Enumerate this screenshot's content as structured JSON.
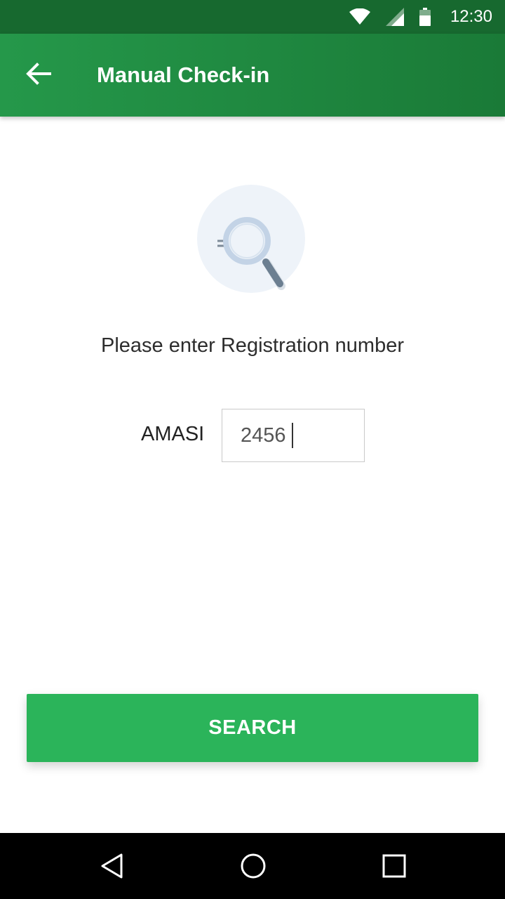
{
  "status_bar": {
    "time": "12:30",
    "icons": [
      "wifi-icon",
      "signal-icon",
      "battery-icon"
    ]
  },
  "app_bar": {
    "title": "Manual Check-in",
    "back_icon": "arrow-left-icon"
  },
  "main": {
    "illustration_icon": "magnifier-search-icon",
    "prompt": "Please enter Registration number",
    "registration": {
      "prefix": "AMASI",
      "value": "2456"
    },
    "search_button_label": "SEARCH"
  },
  "nav_bar": {
    "icons": [
      "back-triangle-icon",
      "home-circle-icon",
      "recents-square-icon"
    ]
  },
  "colors": {
    "status_bar": "#17692f",
    "app_bar": "#1e8a3f",
    "primary_button": "#2bb45a"
  }
}
